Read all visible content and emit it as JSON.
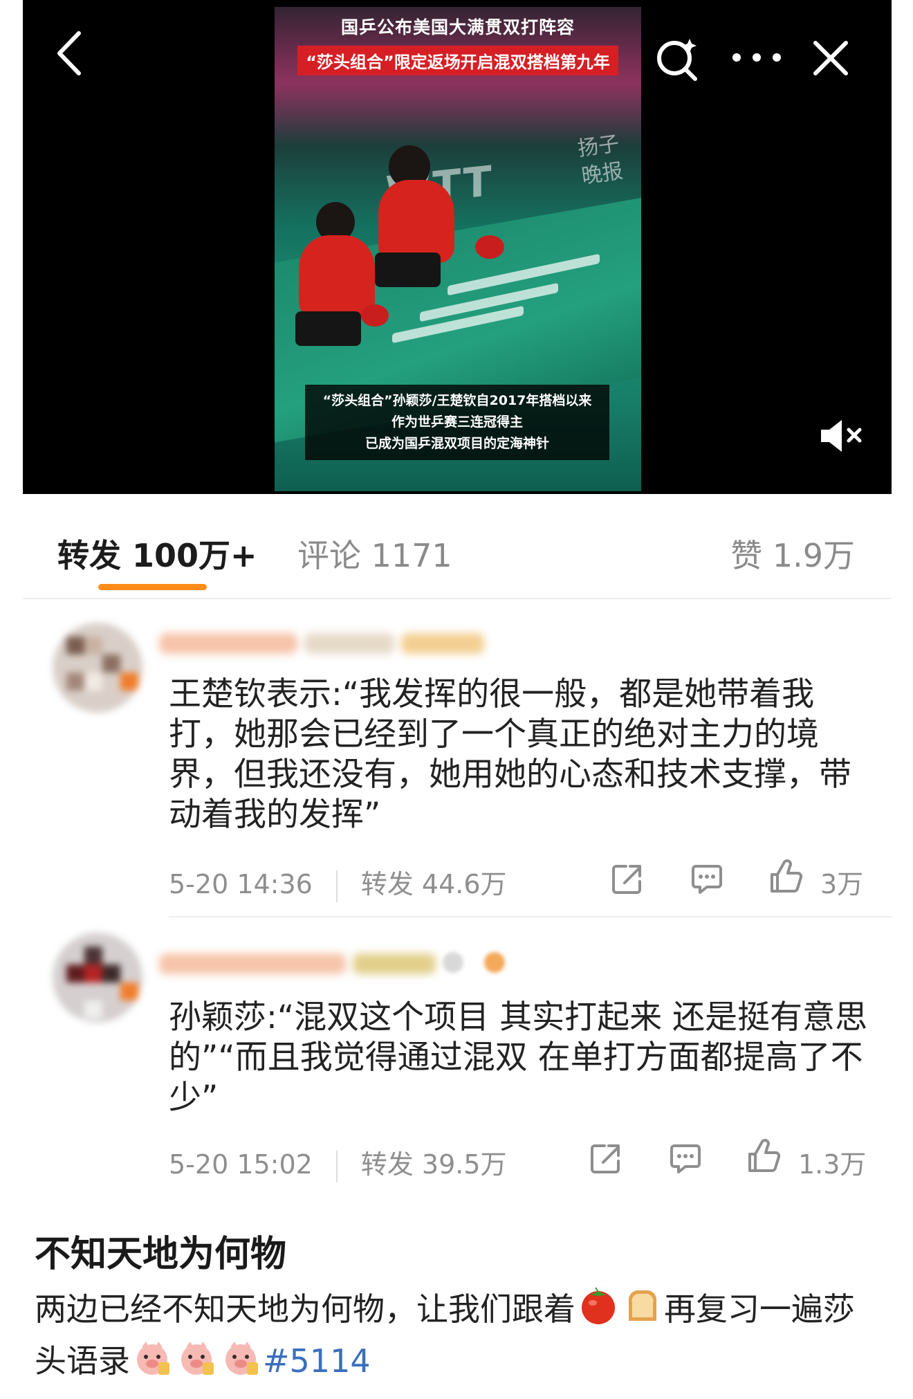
{
  "video": {
    "headline_line1": "国乒公布美国大满贯双打阵容",
    "headline_line2": "“莎头组合”限定返场开启混双搭档第九年",
    "watermark": "扬子晚报",
    "caption_lines": [
      "“莎头组合”孙颖莎/王楚钦自2017年搭档以来",
      "作为世乒赛三连冠得主",
      "已成为国乒混双项目的定海神针"
    ],
    "background_logo": "WTT"
  },
  "tabs": {
    "repost": "转发 100万+",
    "comments": "评论 1171",
    "likes": "赞 1.9万",
    "active": "repost"
  },
  "reposts": [
    {
      "text": "王楚钦表示:“我发挥的很一般，都是她带着我打，她那会已经到了一个真正的绝对主力的境界，但我还没有，她用她的心态和技术支撑，带动着我的发挥”",
      "time": "5-20 14:36",
      "repost_count": "转发 44.6万",
      "likes": "3万"
    },
    {
      "text": "孙颖莎:“混双这个项目 其实打起来 还是挺有意思的”“而且我觉得通过混双 在单打方面都提高了不少”",
      "time": "5-20 15:02",
      "repost_count": "转发 39.5万",
      "likes": "1.3万"
    }
  ],
  "post": {
    "title": "不知天地为何物",
    "body_part1": "两边已经不知天地为何物，让我们跟着",
    "body_part2": "再复习一遍莎头语录",
    "hashtag": "#5114"
  },
  "colors": {
    "accent_orange": "#ff8c1a",
    "headline_red": "#d61f25",
    "hashtag_blue": "#3b6fbd",
    "muted_gray": "#8e8e8e"
  },
  "icons": [
    "back-icon",
    "search-icon",
    "more-icon",
    "close-icon",
    "mute-icon",
    "share-icon",
    "comment-icon",
    "like-icon",
    "tomato-emoji",
    "toast-emoji",
    "pig-emoji"
  ]
}
